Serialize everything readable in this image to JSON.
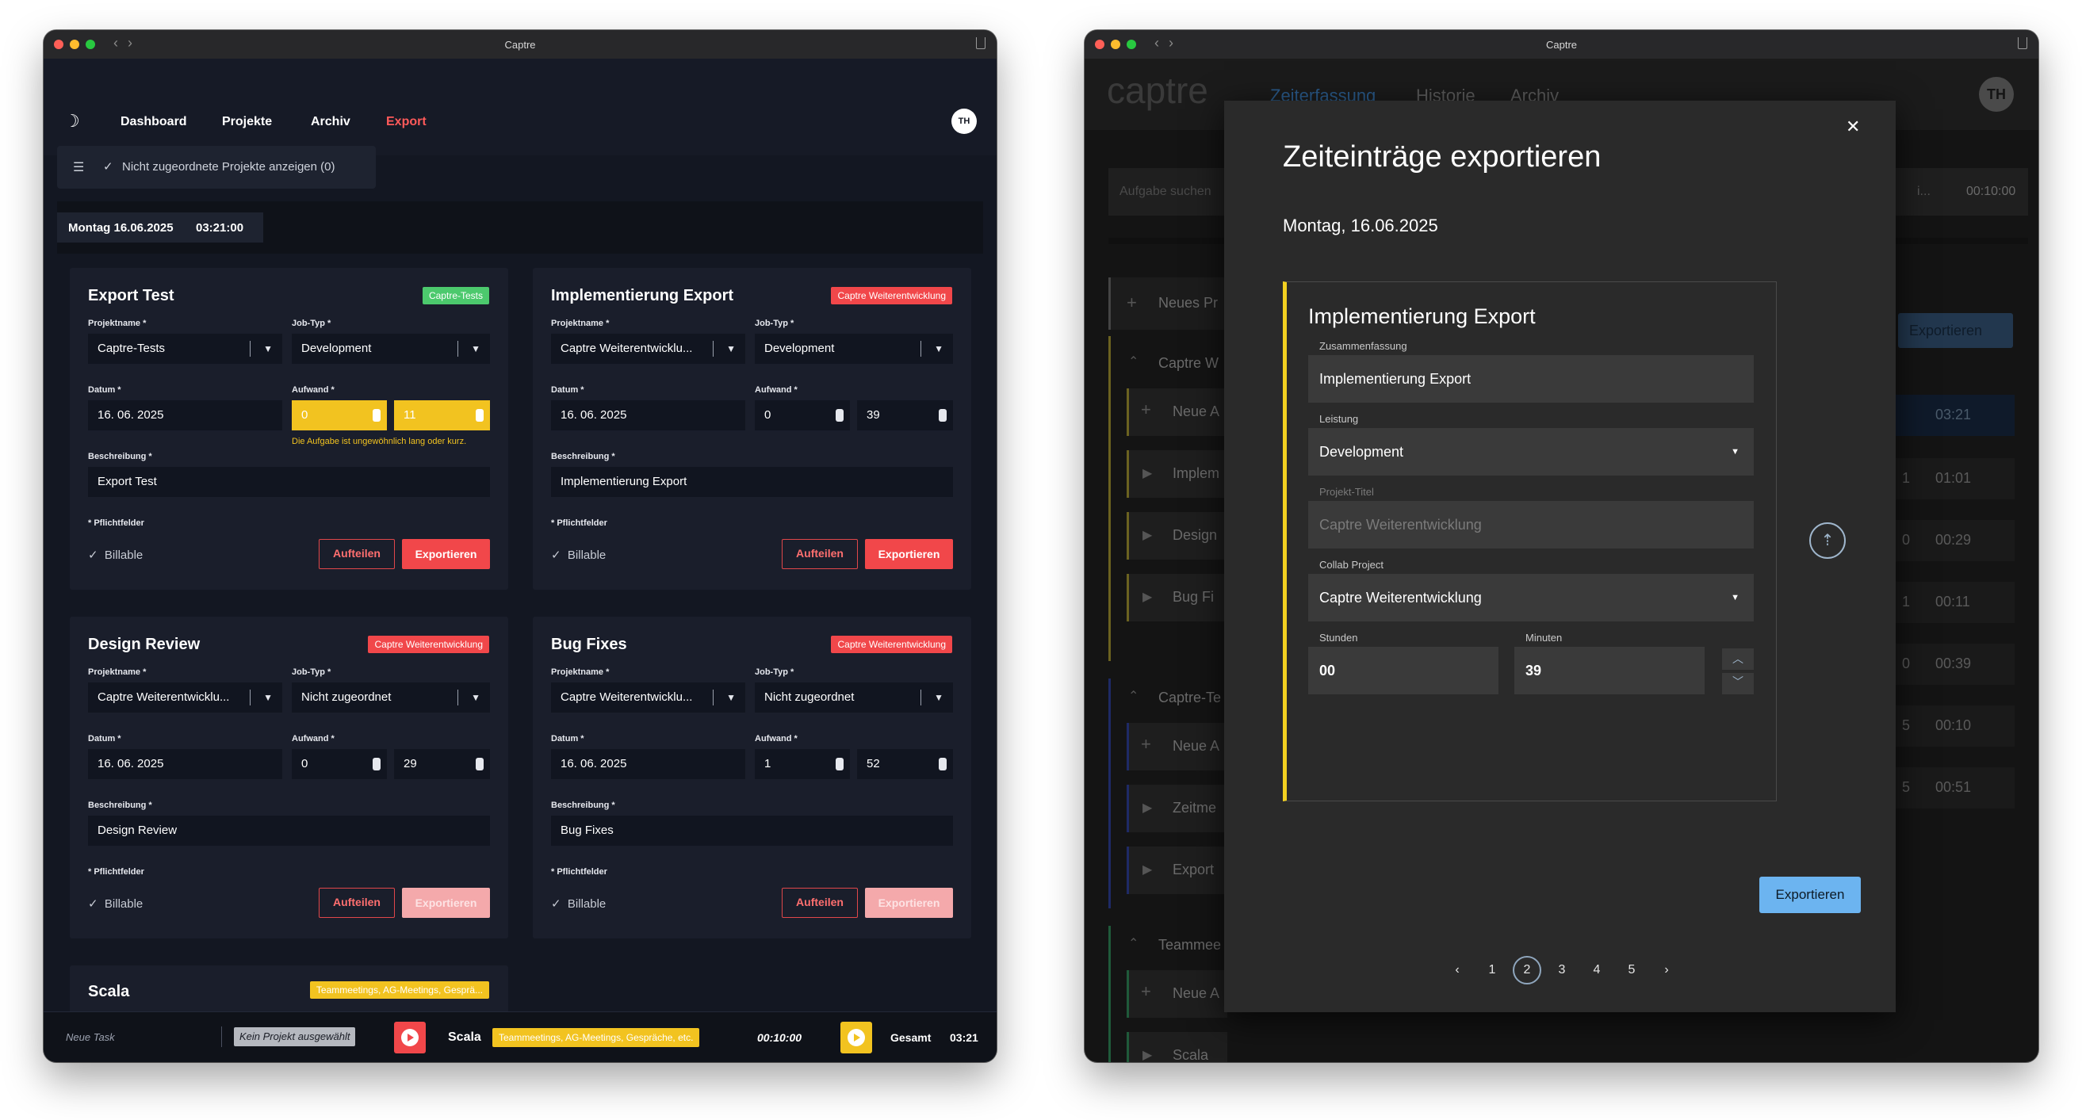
{
  "left_window": {
    "title": "Captre",
    "nav": {
      "dashboard": "Dashboard",
      "projekte": "Projekte",
      "archiv": "Archiv",
      "export": "Export"
    },
    "avatar": "TH",
    "filter_label": "Nicht zugeordnete Projekte anzeigen (0)",
    "date_label": "Montag 16.06.2025",
    "total_time": "03:21:00",
    "labels": {
      "projektname": "Projektname *",
      "jobtyp": "Job-Typ *",
      "datum": "Datum *",
      "aufwand": "Aufwand *",
      "beschreibung": "Beschreibung *",
      "pflicht": "* Pflichtfelder",
      "billable": "Billable",
      "aufteilen": "Aufteilen",
      "exportieren": "Exportieren"
    },
    "cards": [
      {
        "title": "Export Test",
        "tag": "Captre-Tests",
        "projekt": "Captre-Tests",
        "jobtyp": "Development",
        "datum": "16. 06. 2025",
        "hours": "0",
        "minutes": "11",
        "warning": "Die Aufgabe ist ungewöhnlich lang oder kurz.",
        "beschreibung": "Export Test"
      },
      {
        "title": "Implementierung Export",
        "tag": "Captre Weiterentwicklung",
        "projekt": "Captre Weiterentwicklu...",
        "jobtyp": "Development",
        "datum": "16. 06. 2025",
        "hours": "0",
        "minutes": "39",
        "beschreibung": "Implementierung Export"
      },
      {
        "title": "Design Review",
        "tag": "Captre Weiterentwicklung",
        "projekt": "Captre Weiterentwicklu...",
        "jobtyp": "Nicht zugeordnet",
        "datum": "16. 06. 2025",
        "hours": "0",
        "minutes": "29",
        "beschreibung": "Design Review"
      },
      {
        "title": "Bug Fixes",
        "tag": "Captre Weiterentwicklung",
        "projekt": "Captre Weiterentwicklu...",
        "jobtyp": "Nicht zugeordnet",
        "datum": "16. 06. 2025",
        "hours": "1",
        "minutes": "52",
        "beschreibung": "Bug Fixes"
      }
    ],
    "scala_card": {
      "title": "Scala",
      "tag": "Teammeetings, AG-Meetings, Gesprä..."
    },
    "footer": {
      "task_placeholder": "Neue Task",
      "no_project": "Kein Projekt ausgewählt",
      "scala": "Scala",
      "scala_tag": "Teammeetings, AG-Meetings, Gespräche, etc.",
      "timer": "00:10:00",
      "gesamt": "Gesamt",
      "gesamt_value": "03:21"
    },
    "colors": {
      "accent": "#f1474a",
      "green": "#4cc96d",
      "yellow": "#f2c320"
    }
  },
  "right_window": {
    "title": "Captre",
    "logo": "captre",
    "nav": {
      "zeiterfassung": "Zeiterfassung",
      "historie": "Historie",
      "archiv": "Archiv"
    },
    "avatar": "TH",
    "search_placeholder": "Aufgabe suchen",
    "search_suffix": "i...",
    "timer": "00:10:00",
    "export_button": "Exportieren",
    "sidebar": {
      "neues_projekt": "Neues Pr",
      "group1": "Captre W",
      "neue_a": "Neue A",
      "item_impl": "Implem",
      "item_design": "Design",
      "item_bug": "Bug Fi",
      "group2": "Captre-Te",
      "item_zeit": "Zeitme",
      "item_export": "Export",
      "group3": "Teammee",
      "item_scala": "Scala"
    },
    "times": [
      {
        "prefix": "",
        "value": "03:21"
      },
      {
        "prefix": "1",
        "value": "01:01"
      },
      {
        "prefix": "0",
        "value": "00:29"
      },
      {
        "prefix": "1",
        "value": "00:11"
      },
      {
        "prefix": "0",
        "value": "00:39"
      },
      {
        "prefix": "5",
        "value": "00:10"
      },
      {
        "prefix": "5",
        "value": "00:51"
      }
    ],
    "dialog": {
      "title": "Zeiteinträge exportieren",
      "date": "Montag, 16.06.2025",
      "entry_title": "Implementierung Export",
      "zusammenfassung_label": "Zusammenfassung",
      "zusammenfassung": "Implementierung Export",
      "leistung_label": "Leistung",
      "leistung": "Development",
      "projekt_label": "Projekt-Titel",
      "projekt": "Captre Weiterentwicklung",
      "collab_label": "Collab Project",
      "collab": "Captre Weiterentwicklung",
      "stunden_label": "Stunden",
      "stunden": "00",
      "minuten_label": "Minuten",
      "minuten": "39",
      "export_button": "Exportieren",
      "pages": [
        "1",
        "2",
        "3",
        "4",
        "5"
      ],
      "current_page": "2"
    }
  }
}
